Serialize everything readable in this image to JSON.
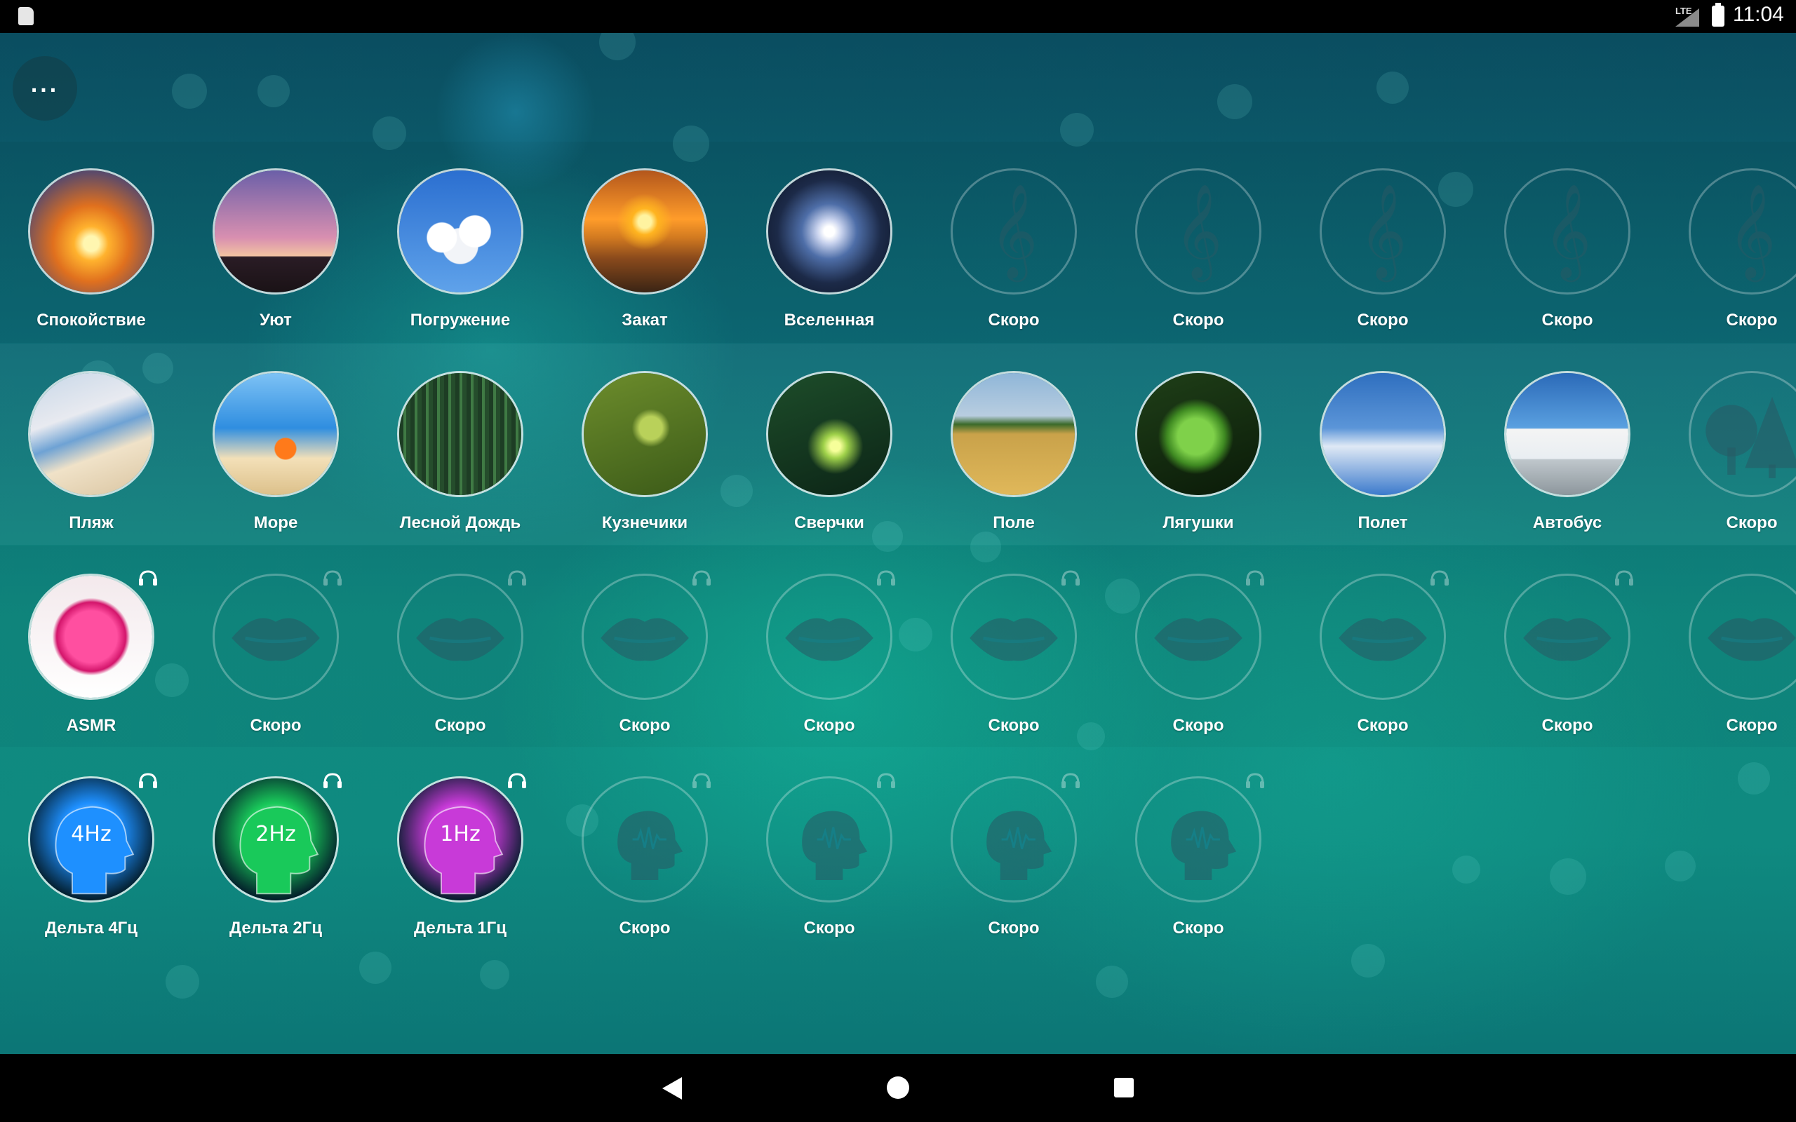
{
  "status_bar": {
    "network": "LTE",
    "time": "11:04"
  },
  "menu_label": "...",
  "rows": [
    {
      "items": [
        {
          "label": "Спокойствие",
          "state": "active",
          "icon": "sunset-clouds-image",
          "headphones": false
        },
        {
          "label": "Уют",
          "state": "active",
          "icon": "palm-trees-image",
          "headphones": false
        },
        {
          "label": "Погружение",
          "state": "active",
          "icon": "clouds-sky-image",
          "headphones": false
        },
        {
          "label": "Закат",
          "state": "active",
          "icon": "beach-sunset-image",
          "headphones": false
        },
        {
          "label": "Вселенная",
          "state": "active",
          "icon": "galaxy-image",
          "headphones": false
        },
        {
          "label": "Скоро",
          "state": "locked",
          "icon": "treble-clef-icon",
          "headphones": false
        },
        {
          "label": "Скоро",
          "state": "locked",
          "icon": "treble-clef-icon",
          "headphones": false
        },
        {
          "label": "Скоро",
          "state": "locked",
          "icon": "treble-clef-icon",
          "headphones": false
        },
        {
          "label": "Скоро",
          "state": "locked",
          "icon": "treble-clef-icon",
          "headphones": false
        },
        {
          "label": "Скоро",
          "state": "locked",
          "icon": "treble-clef-icon",
          "headphones": false
        }
      ]
    },
    {
      "items": [
        {
          "label": "Пляж",
          "state": "active",
          "icon": "beach-waves-image",
          "headphones": false
        },
        {
          "label": "Море",
          "state": "active",
          "icon": "starfish-sea-image",
          "headphones": false
        },
        {
          "label": "Лесной Дождь",
          "state": "active",
          "icon": "forest-rain-image",
          "headphones": false
        },
        {
          "label": "Кузнечики",
          "state": "active",
          "icon": "grasshopper-image",
          "headphones": false
        },
        {
          "label": "Сверчки",
          "state": "active",
          "icon": "cricket-night-image",
          "headphones": false
        },
        {
          "label": "Поле",
          "state": "active",
          "icon": "wheat-field-image",
          "headphones": false
        },
        {
          "label": "Лягушки",
          "state": "active",
          "icon": "frog-image",
          "headphones": false
        },
        {
          "label": "Полет",
          "state": "active",
          "icon": "airplane-image",
          "headphones": false
        },
        {
          "label": "Автобус",
          "state": "active",
          "icon": "bus-image",
          "headphones": false
        },
        {
          "label": "Скоро",
          "state": "locked",
          "icon": "trees-icon",
          "headphones": false
        }
      ]
    },
    {
      "items": [
        {
          "label": "ASMR",
          "state": "active",
          "icon": "lips-image",
          "headphones": true
        },
        {
          "label": "Скоро",
          "state": "locked",
          "icon": "lips-icon",
          "headphones": true
        },
        {
          "label": "Скоро",
          "state": "locked",
          "icon": "lips-icon",
          "headphones": true
        },
        {
          "label": "Скоро",
          "state": "locked",
          "icon": "lips-icon",
          "headphones": true
        },
        {
          "label": "Скоро",
          "state": "locked",
          "icon": "lips-icon",
          "headphones": true
        },
        {
          "label": "Скоро",
          "state": "locked",
          "icon": "lips-icon",
          "headphones": true
        },
        {
          "label": "Скоро",
          "state": "locked",
          "icon": "lips-icon",
          "headphones": true
        },
        {
          "label": "Скоро",
          "state": "locked",
          "icon": "lips-icon",
          "headphones": true
        },
        {
          "label": "Скоро",
          "state": "locked",
          "icon": "lips-icon",
          "headphones": true
        },
        {
          "label": "Скоро",
          "state": "locked",
          "icon": "lips-icon",
          "headphones": false
        }
      ]
    },
    {
      "items": [
        {
          "label": "Дельта 4Гц",
          "state": "active",
          "icon": "brain-head-blue",
          "badge": "4Hz",
          "color": "#1e90ff",
          "headphones": true
        },
        {
          "label": "Дельта 2Гц",
          "state": "active",
          "icon": "brain-head-green",
          "badge": "2Hz",
          "color": "#19c95a",
          "headphones": true
        },
        {
          "label": "Дельта 1Гц",
          "state": "active",
          "icon": "brain-head-purple",
          "badge": "1Hz",
          "color": "#c83ad8",
          "headphones": true
        },
        {
          "label": "Скоро",
          "state": "locked",
          "icon": "head-wave-icon",
          "headphones": true
        },
        {
          "label": "Скоро",
          "state": "locked",
          "icon": "head-wave-icon",
          "headphones": true
        },
        {
          "label": "Скоро",
          "state": "locked",
          "icon": "head-wave-icon",
          "headphones": true
        },
        {
          "label": "Скоро",
          "state": "locked",
          "icon": "head-wave-icon",
          "headphones": true
        }
      ]
    }
  ]
}
